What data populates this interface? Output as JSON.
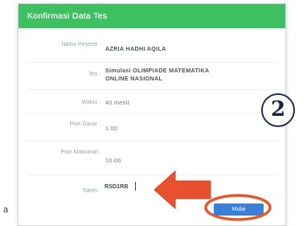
{
  "dialog": {
    "title": "Konfirmasi Data Tes"
  },
  "fields": [
    {
      "label": "Nama Peserta :",
      "value": "AZRIA HADHI AQILA"
    },
    {
      "label": "Tes :",
      "value": "Simulasi OLIMPIADE MATEMATIKA ONLINE NASIONAL"
    },
    {
      "label": "Waktu :",
      "value": "40 menit"
    },
    {
      "label": "Poin Dasar :",
      "value": "1.00"
    },
    {
      "label": "Poin Maksimal :",
      "value": "10.00"
    }
  ],
  "token": {
    "label": "Token :",
    "value": "RSD1RB"
  },
  "submit_label": "Mulai",
  "annotation": {
    "step_number": "2",
    "side_text": "a"
  },
  "colors": {
    "header": "#3dbf62",
    "button": "#3a7fd9",
    "arrow": "#e8512e",
    "highlight_ring": "#e05a30",
    "badge_ring": "#1f2f55"
  }
}
